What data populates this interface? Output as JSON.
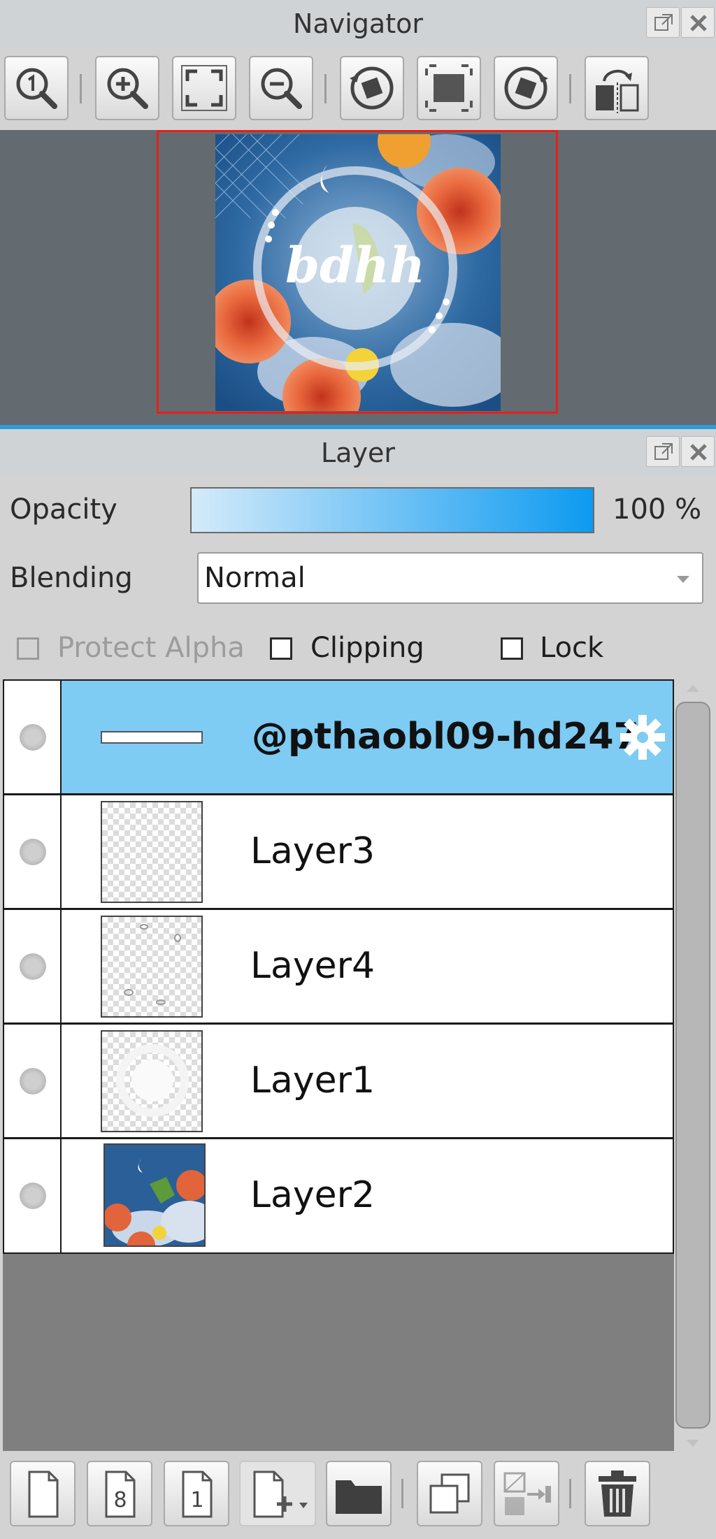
{
  "navigator": {
    "title": "Navigator",
    "canvas_preview": {
      "text": "bdhh"
    }
  },
  "layer_panel": {
    "title": "Layer",
    "opacity": {
      "label": "Opacity",
      "value_text": "100 %",
      "value": 100
    },
    "blending": {
      "label": "Blending",
      "value": "Normal"
    },
    "options": [
      {
        "label": "Protect Alpha",
        "checked": false,
        "enabled": false
      },
      {
        "label": "Clipping",
        "checked": false,
        "enabled": true
      },
      {
        "label": "Lock",
        "checked": false,
        "enabled": true
      }
    ],
    "layers": [
      {
        "name": "@pthaobl09-hd247",
        "selected": true,
        "type": "text"
      },
      {
        "name": "Layer3",
        "selected": false,
        "type": "raster"
      },
      {
        "name": "Layer4",
        "selected": false,
        "type": "raster"
      },
      {
        "name": "Layer1",
        "selected": false,
        "type": "raster"
      },
      {
        "name": "Layer2",
        "selected": false,
        "type": "image"
      }
    ],
    "bottom_toolbar": {
      "layer_8bit_icon_text": "8",
      "layer_1bit_icon_text": "1"
    }
  },
  "colors": {
    "accent": "#0d9af0",
    "selection": "#7ecbf3",
    "nav_frame": "#e52018"
  }
}
